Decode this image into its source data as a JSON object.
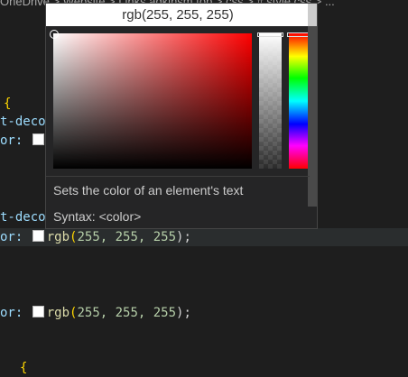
{
  "breadcrumb": "OneDrive > Website > Links.adkinsm.tob > css > # style.css > ...",
  "code": {
    "brace": "{",
    "deco": "t-deco",
    "color_prop": "or:",
    "rgb_fn": "rgb",
    "rgb_args": "255, 255, 255",
    "open_paren": "(",
    "close": ");"
  },
  "popup": {
    "color_value": "rgb(255, 255, 255)",
    "description": "Sets the color of an element's text",
    "syntax": "Syntax: <color>",
    "selected_hue_deg": 0,
    "opacity": 1
  }
}
